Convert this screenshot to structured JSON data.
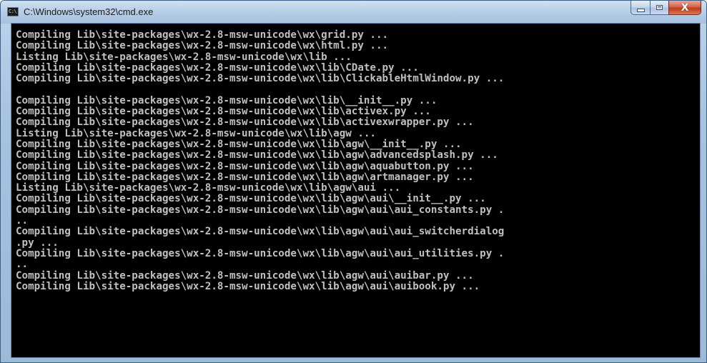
{
  "window": {
    "title": "C:\\Windows\\system32\\cmd.exe",
    "icon": "console-app-icon",
    "icon_text": "C:\\",
    "colors": {
      "console_background": "#000000",
      "console_text": "#c0c0c0",
      "frame": "#a7c2df",
      "close_button": "#c0391d"
    }
  },
  "caption_buttons": {
    "minimize_icon": "minimize-icon",
    "maximize_icon": "maximize-icon",
    "close_icon": "close-icon",
    "close_glyph": "X"
  },
  "console": {
    "lines": [
      "Compiling Lib\\site-packages\\wx-2.8-msw-unicode\\wx\\grid.py ...",
      "Compiling Lib\\site-packages\\wx-2.8-msw-unicode\\wx\\html.py ...",
      "Listing Lib\\site-packages\\wx-2.8-msw-unicode\\wx\\lib ...",
      "Compiling Lib\\site-packages\\wx-2.8-msw-unicode\\wx\\lib\\CDate.py ...",
      "Compiling Lib\\site-packages\\wx-2.8-msw-unicode\\wx\\lib\\ClickableHtmlWindow.py ...",
      "",
      "Compiling Lib\\site-packages\\wx-2.8-msw-unicode\\wx\\lib\\__init__.py ...",
      "Compiling Lib\\site-packages\\wx-2.8-msw-unicode\\wx\\lib\\activex.py ...",
      "Compiling Lib\\site-packages\\wx-2.8-msw-unicode\\wx\\lib\\activexwrapper.py ...",
      "Listing Lib\\site-packages\\wx-2.8-msw-unicode\\wx\\lib\\agw ...",
      "Compiling Lib\\site-packages\\wx-2.8-msw-unicode\\wx\\lib\\agw\\__init__.py ...",
      "Compiling Lib\\site-packages\\wx-2.8-msw-unicode\\wx\\lib\\agw\\advancedsplash.py ...",
      "Compiling Lib\\site-packages\\wx-2.8-msw-unicode\\wx\\lib\\agw\\aquabutton.py ...",
      "Compiling Lib\\site-packages\\wx-2.8-msw-unicode\\wx\\lib\\agw\\artmanager.py ...",
      "Listing Lib\\site-packages\\wx-2.8-msw-unicode\\wx\\lib\\agw\\aui ...",
      "Compiling Lib\\site-packages\\wx-2.8-msw-unicode\\wx\\lib\\agw\\aui\\__init__.py ...",
      "Compiling Lib\\site-packages\\wx-2.8-msw-unicode\\wx\\lib\\agw\\aui\\aui_constants.py .",
      "..",
      "Compiling Lib\\site-packages\\wx-2.8-msw-unicode\\wx\\lib\\agw\\aui\\aui_switcherdialog",
      ".py ...",
      "Compiling Lib\\site-packages\\wx-2.8-msw-unicode\\wx\\lib\\agw\\aui\\aui_utilities.py .",
      "..",
      "Compiling Lib\\site-packages\\wx-2.8-msw-unicode\\wx\\lib\\agw\\aui\\auibar.py ...",
      "Compiling Lib\\site-packages\\wx-2.8-msw-unicode\\wx\\lib\\agw\\aui\\auibook.py ..."
    ]
  }
}
